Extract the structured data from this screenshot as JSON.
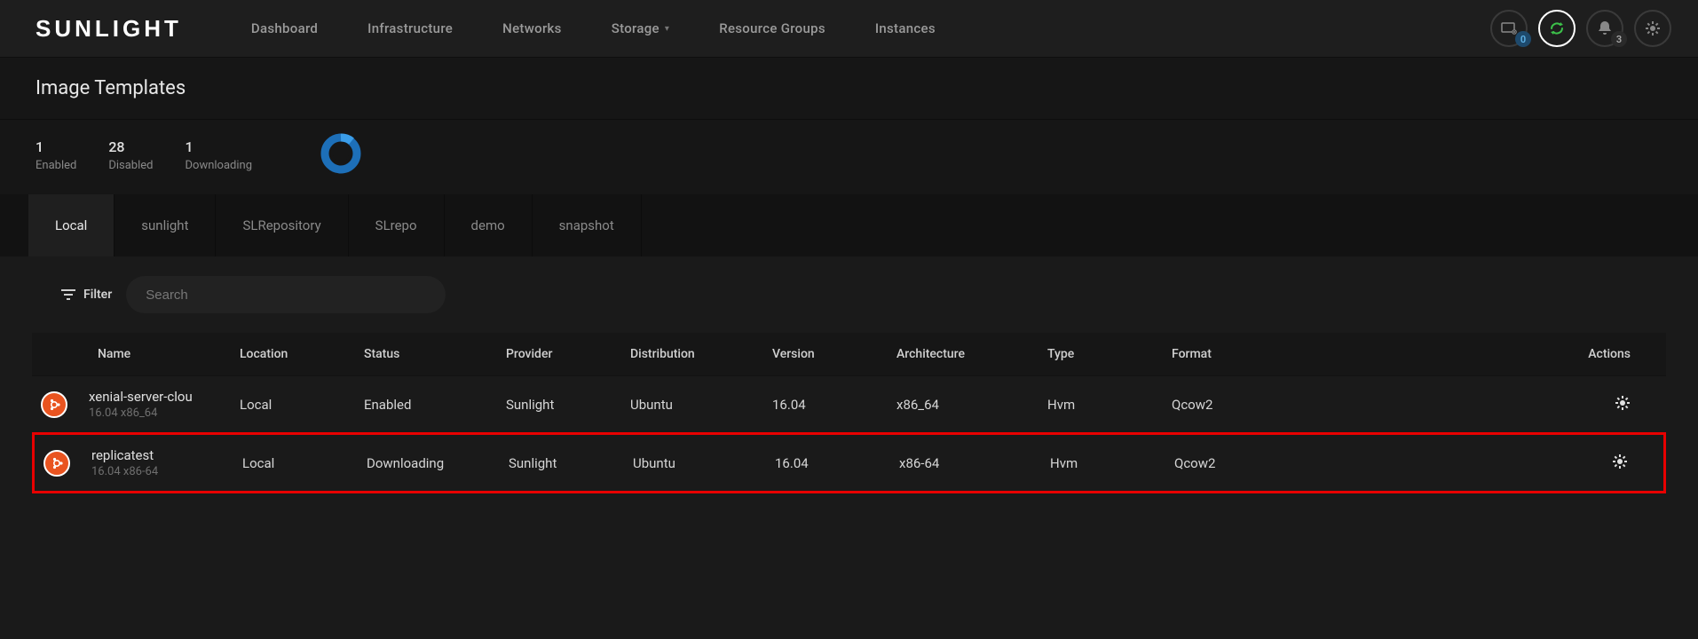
{
  "brand": "SUNLIGHT",
  "nav": {
    "dashboard": "Dashboard",
    "infrastructure": "Infrastructure",
    "networks": "Networks",
    "storage": "Storage",
    "resource_groups": "Resource Groups",
    "instances": "Instances"
  },
  "top_icons": {
    "monitor_badge": "0",
    "notifications_badge": "3"
  },
  "page": {
    "title": "Image Templates"
  },
  "stats": {
    "enabled": {
      "value": "1",
      "label": "Enabled"
    },
    "disabled": {
      "value": "28",
      "label": "Disabled"
    },
    "downloading": {
      "value": "1",
      "label": "Downloading"
    }
  },
  "tabs": [
    "Local",
    "sunlight",
    "SLRepository",
    "SLrepo",
    "demo",
    "snapshot"
  ],
  "filter": {
    "label": "Filter",
    "search_placeholder": "Search"
  },
  "columns": {
    "name": "Name",
    "location": "Location",
    "status": "Status",
    "provider": "Provider",
    "distribution": "Distribution",
    "version": "Version",
    "architecture": "Architecture",
    "type": "Type",
    "format": "Format",
    "actions": "Actions"
  },
  "rows": [
    {
      "name": "xenial-server-clou",
      "subtitle": "16.04 x86_64",
      "location": "Local",
      "status": "Enabled",
      "provider": "Sunlight",
      "distribution": "Ubuntu",
      "version": "16.04",
      "architecture": "x86_64",
      "type": "Hvm",
      "format": "Qcow2",
      "highlighted": false
    },
    {
      "name": "replicatest",
      "subtitle": "16.04 x86-64",
      "location": "Local",
      "status": "Downloading",
      "provider": "Sunlight",
      "distribution": "Ubuntu",
      "version": "16.04",
      "architecture": "x86-64",
      "type": "Hvm",
      "format": "Qcow2",
      "highlighted": true
    }
  ]
}
